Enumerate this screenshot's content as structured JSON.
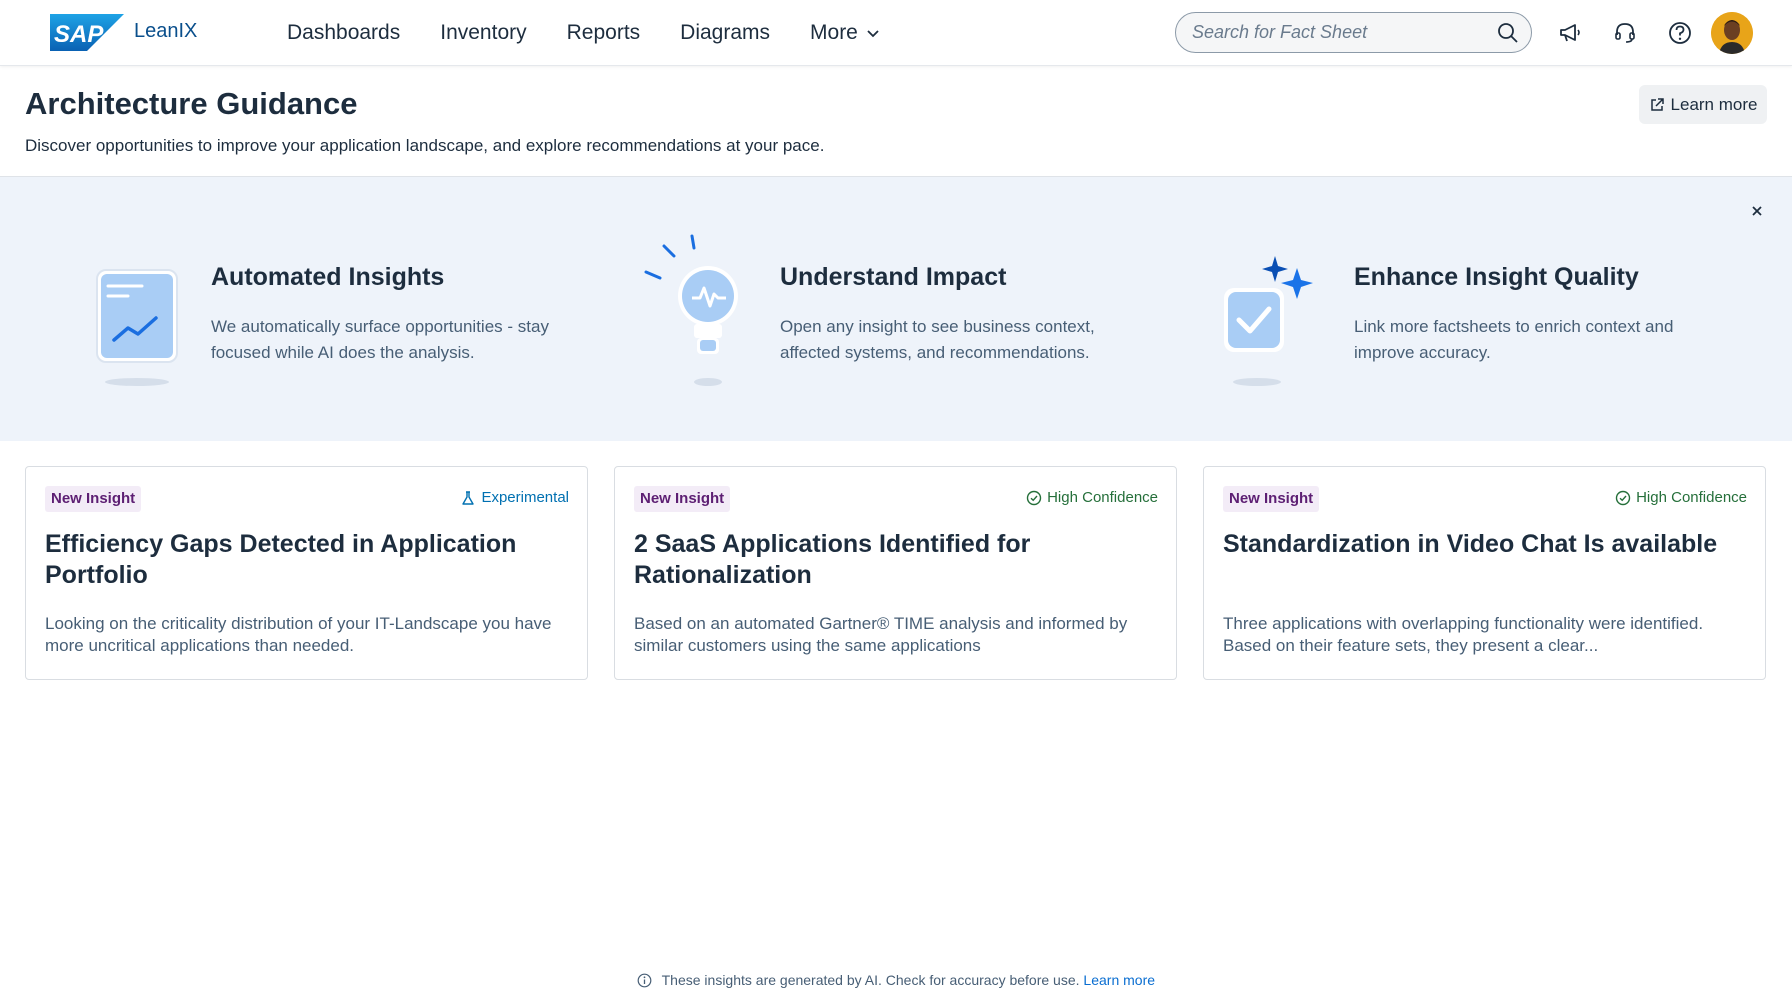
{
  "app": {
    "brand": "LeanIX",
    "logo_text": "SAP"
  },
  "nav": [
    {
      "label": "Dashboards"
    },
    {
      "label": "Inventory"
    },
    {
      "label": "Reports"
    },
    {
      "label": "Diagrams"
    },
    {
      "label": "More"
    }
  ],
  "search": {
    "placeholder": "Search for Fact Sheet",
    "icon": "search-icon"
  },
  "toolbar_icons": [
    "megaphone-icon",
    "headset-icon",
    "help-icon"
  ],
  "header": {
    "title": "Architecture Guidance",
    "subtitle": "Discover opportunities to improve your application landscape, and explore recommendations at your pace.",
    "learn_more": "Learn more"
  },
  "banner": {
    "features": [
      {
        "title": "Automated Insights",
        "text": "We automatically surface opportunities - stay focused while AI does the analysis.",
        "icon": "chart-document-icon"
      },
      {
        "title": "Understand Impact",
        "text": "Open any insight to see business context, affected systems, and recommendations.",
        "icon": "lightbulb-icon"
      },
      {
        "title": "Enhance Insight Quality",
        "text": "Link more factsheets to enrich context and improve accuracy.",
        "icon": "sparkle-check-icon"
      }
    ]
  },
  "cards": [
    {
      "badge": "New Insight",
      "confidence": "Experimental",
      "confidence_icon": "flask-icon",
      "confidence_color": "#0070b1",
      "title": "Efficiency Gaps Detected in Application Portfolio",
      "description": "Looking on the criticality distribution of your IT-Landscape you have more uncritical applications than needed."
    },
    {
      "badge": "New Insight",
      "confidence": "High Confidence",
      "confidence_icon": "check-circle-icon",
      "confidence_color": "#256f3a",
      "title": "2 SaaS Applications Identified for Rationalization",
      "description": "Based on an automated Gartner® TIME analysis and informed by similar customers using the same applications"
    },
    {
      "badge": "New Insight",
      "confidence": "High Confidence",
      "confidence_icon": "check-circle-icon",
      "confidence_color": "#256f3a",
      "title": "Standardization in Video Chat Is available",
      "description": "Three applications with overlapping functionality were identified. Based on their feature sets, they present a clear..."
    }
  ],
  "footer": {
    "text": "These insights are generated by AI. Check for accuracy before use.",
    "link": "Learn more"
  },
  "colors": {
    "brand_blue": "#0a6ed1",
    "banner_bg": "#eef3fa",
    "badge_bg": "#f3ecf7",
    "badge_text": "#5d1f73"
  }
}
